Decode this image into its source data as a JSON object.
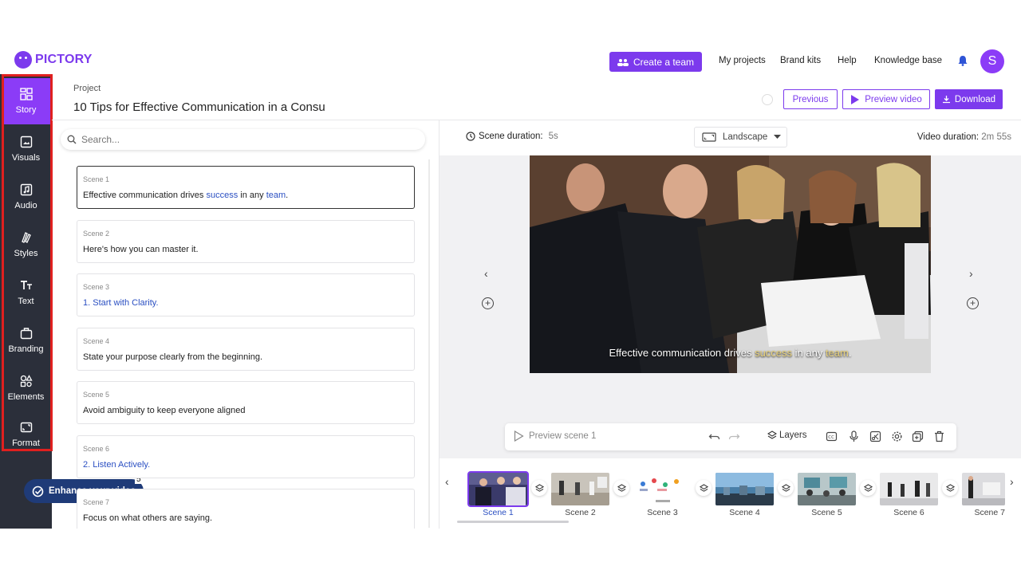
{
  "brand": {
    "name": "PICTORY",
    "accent": "#7c3aed"
  },
  "topnav": {
    "create_team": "Create a team",
    "links": [
      "My projects",
      "Brand kits",
      "Help",
      "Knowledge base"
    ],
    "avatar_initial": "S"
  },
  "rail": {
    "items": [
      {
        "label": "Story",
        "icon": "story-grid-icon",
        "active": true
      },
      {
        "label": "Visuals",
        "icon": "image-icon"
      },
      {
        "label": "Audio",
        "icon": "music-note-icon"
      },
      {
        "label": "Styles",
        "icon": "styles-icon"
      },
      {
        "label": "Text",
        "icon": "text-icon"
      },
      {
        "label": "Branding",
        "icon": "briefcase-icon"
      },
      {
        "label": "Elements",
        "icon": "shapes-icon"
      },
      {
        "label": "Format",
        "icon": "aspect-icon"
      }
    ],
    "enhance_label": "Enhance your video",
    "enhance_badge": "5"
  },
  "project": {
    "label": "Project",
    "title": "10 Tips for Effective Communication in a Consu"
  },
  "actions": {
    "previous": "Previous",
    "preview": "Preview video",
    "download": "Download"
  },
  "search": {
    "placeholder": "Search..."
  },
  "scenes": [
    {
      "num": "Scene 1",
      "pre": "Effective communication drives ",
      "hl1": "success",
      "mid": " in any ",
      "hl2": "team",
      "post": "."
    },
    {
      "num": "Scene 2",
      "text": "Here's how you can master it."
    },
    {
      "num": "Scene 3",
      "text": "1. Start with Clarity."
    },
    {
      "num": "Scene 4",
      "text": "State your purpose clearly from the beginning."
    },
    {
      "num": "Scene 5",
      "text": "Avoid ambiguity to keep everyone aligned"
    },
    {
      "num": "Scene 6",
      "text": "2. Listen Actively."
    },
    {
      "num": "Scene 7",
      "text": "Focus on what others are saying."
    }
  ],
  "editor": {
    "scene_duration_label": "Scene duration:",
    "scene_duration_value": "5s",
    "orientation": "Landscape",
    "video_duration_label": "Video duration:",
    "video_duration_value": "2m 55s",
    "caption_pre": "Effective communication drives ",
    "caption_hl1": "success",
    "caption_mid": " in any ",
    "caption_hl2": "team",
    "caption_post": ".",
    "preview_scene": "Preview scene 1",
    "layers": "Layers"
  },
  "timeline": [
    "Scene 1",
    "Scene 2",
    "Scene 3",
    "Scene 4",
    "Scene 5",
    "Scene 6",
    "Scene 7"
  ]
}
